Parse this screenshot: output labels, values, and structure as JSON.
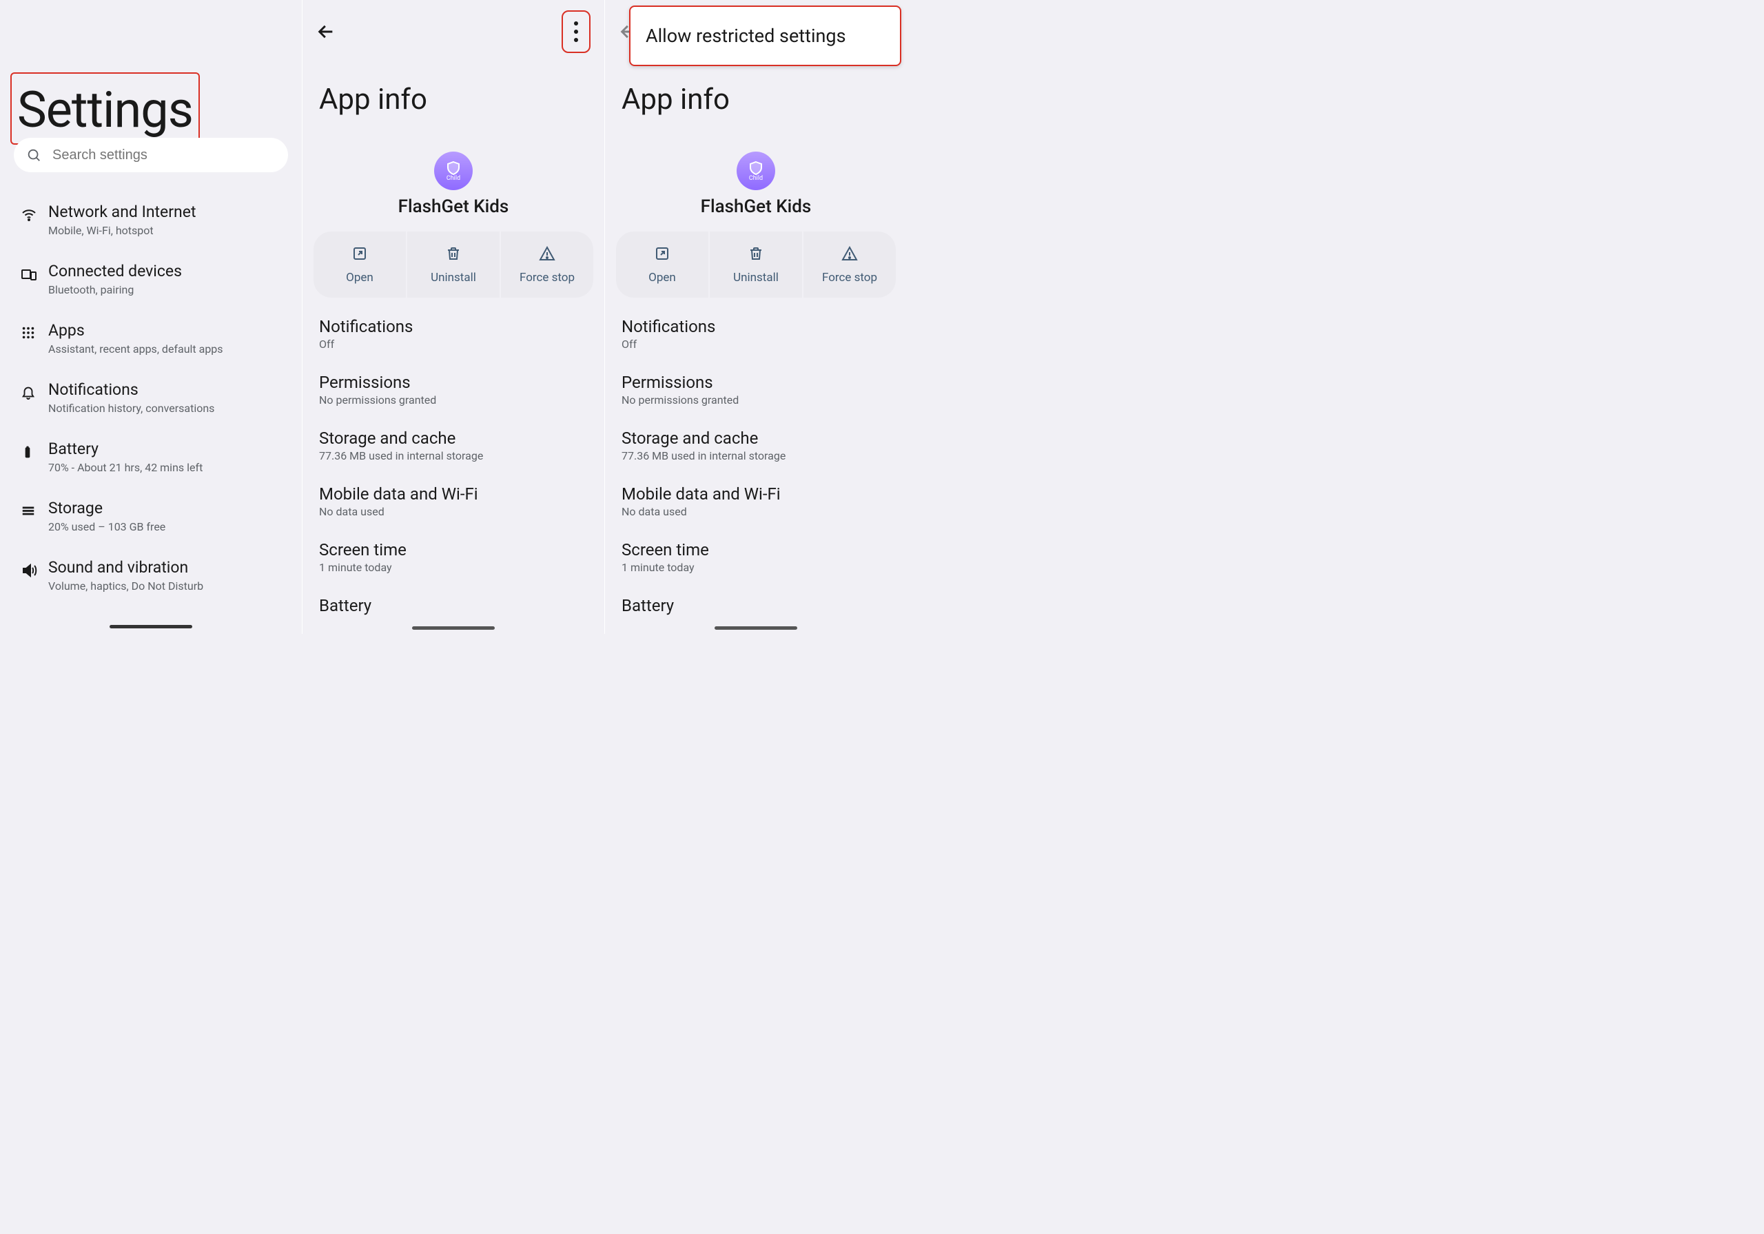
{
  "panel1": {
    "title": "Settings",
    "search_placeholder": "Search settings",
    "items": [
      {
        "icon": "wifi",
        "label": "Network and Internet",
        "sub": "Mobile, Wi-Fi, hotspot"
      },
      {
        "icon": "devices",
        "label": "Connected devices",
        "sub": "Bluetooth, pairing"
      },
      {
        "icon": "apps",
        "label": "Apps",
        "sub": "Assistant, recent apps, default apps"
      },
      {
        "icon": "bell",
        "label": "Notifications",
        "sub": "Notification history, conversations"
      },
      {
        "icon": "battery",
        "label": "Battery",
        "sub": "70% - About 21 hrs, 42 mins left"
      },
      {
        "icon": "storage",
        "label": "Storage",
        "sub": "20% used – 103 GB free"
      },
      {
        "icon": "sound",
        "label": "Sound and vibration",
        "sub": "Volume, haptics, Do Not Disturb"
      }
    ]
  },
  "panel2": {
    "page_title": "App info",
    "app_name": "FlashGet Kids",
    "app_icon_label": "Child",
    "actions": {
      "open": "Open",
      "uninstall": "Uninstall",
      "force_stop": "Force stop"
    },
    "details": [
      {
        "label": "Notifications",
        "sub": "Off"
      },
      {
        "label": "Permissions",
        "sub": "No permissions granted"
      },
      {
        "label": "Storage and cache",
        "sub": "77.36 MB used in internal storage"
      },
      {
        "label": "Mobile data and Wi-Fi",
        "sub": "No data used"
      },
      {
        "label": "Screen time",
        "sub": "1 minute today"
      },
      {
        "label": "Battery",
        "sub": ""
      }
    ]
  },
  "panel3": {
    "page_title": "App info",
    "popup_label": "Allow restricted settings",
    "app_name": "FlashGet Kids",
    "app_icon_label": "Child",
    "actions": {
      "open": "Open",
      "uninstall": "Uninstall",
      "force_stop": "Force stop"
    },
    "details": [
      {
        "label": "Notifications",
        "sub": "Off"
      },
      {
        "label": "Permissions",
        "sub": "No permissions granted"
      },
      {
        "label": "Storage and cache",
        "sub": "77.36 MB used in internal storage"
      },
      {
        "label": "Mobile data and Wi-Fi",
        "sub": "No data used"
      },
      {
        "label": "Screen time",
        "sub": "1 minute today"
      },
      {
        "label": "Battery",
        "sub": ""
      }
    ]
  }
}
